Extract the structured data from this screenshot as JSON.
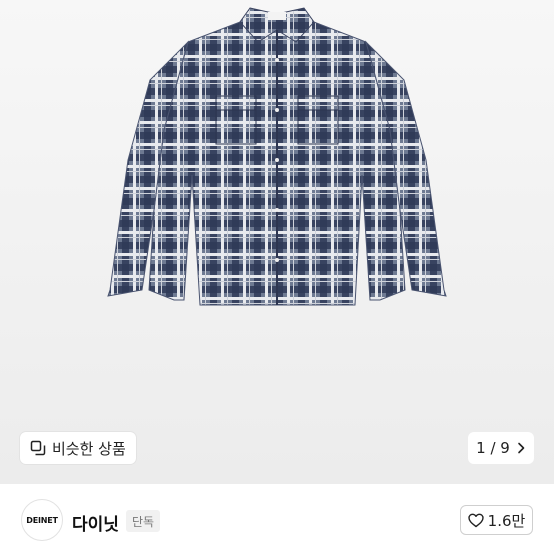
{
  "gallery": {
    "similar_label": "비슷한 상품",
    "pager_text": "1 / 9"
  },
  "seller": {
    "avatar_text": "DEINET",
    "name": "다이닛",
    "badge": "단독"
  },
  "like": {
    "count": "1.6만"
  },
  "icons": {
    "similar": "copy-squares-icon",
    "pager": "chevron-right-icon",
    "like": "heart-outline-icon"
  },
  "colors": {
    "background": "#ececec",
    "shirt_navy": "#3a4563",
    "shirt_light": "#d8dbe2"
  }
}
